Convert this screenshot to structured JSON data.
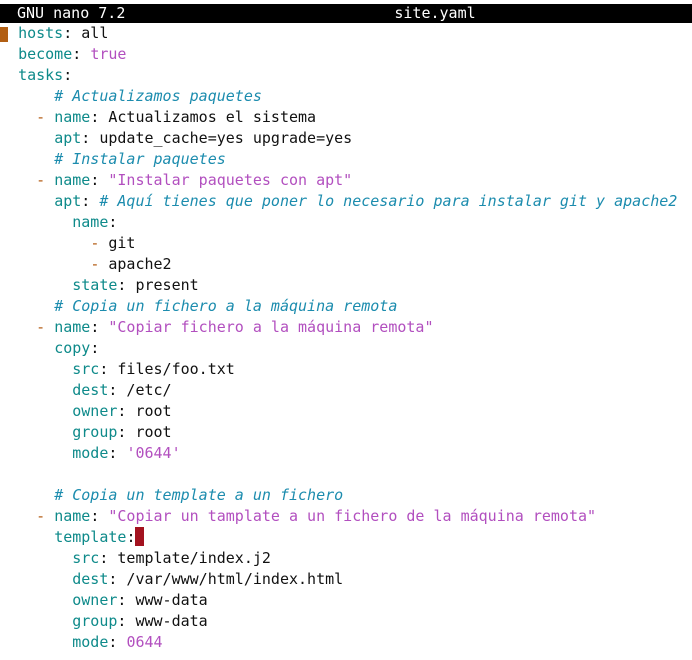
{
  "titlebar": {
    "app": "GNU nano 7.2",
    "filename": "site.yaml"
  },
  "editor": {
    "lines": [
      [
        {
          "t": "hosts",
          "c": "k"
        },
        {
          "t": ": all",
          "c": "p"
        }
      ],
      [
        {
          "t": "become",
          "c": "k"
        },
        {
          "t": ": ",
          "c": "p"
        },
        {
          "t": "true",
          "c": "s"
        }
      ],
      [
        {
          "t": "tasks",
          "c": "k"
        },
        {
          "t": ":",
          "c": "p"
        }
      ],
      [
        {
          "t": "    ",
          "c": "p"
        },
        {
          "t": "# Actualizamos paquetes",
          "c": "c"
        }
      ],
      [
        {
          "t": "  ",
          "c": "p"
        },
        {
          "t": "- ",
          "c": "d"
        },
        {
          "t": "name",
          "c": "k"
        },
        {
          "t": ": Actualizamos el sistema",
          "c": "p"
        }
      ],
      [
        {
          "t": "    ",
          "c": "p"
        },
        {
          "t": "apt",
          "c": "k"
        },
        {
          "t": ": update_cache=yes upgrade=yes",
          "c": "p"
        }
      ],
      [
        {
          "t": "    ",
          "c": "p"
        },
        {
          "t": "# Instalar paquetes",
          "c": "c"
        }
      ],
      [
        {
          "t": "  ",
          "c": "p"
        },
        {
          "t": "- ",
          "c": "d"
        },
        {
          "t": "name",
          "c": "k"
        },
        {
          "t": ": ",
          "c": "p"
        },
        {
          "t": "\"Instalar paquetes con apt\"",
          "c": "s"
        }
      ],
      [
        {
          "t": "    ",
          "c": "p"
        },
        {
          "t": "apt",
          "c": "k"
        },
        {
          "t": ": ",
          "c": "p"
        },
        {
          "t": "# Aquí tienes que poner lo necesario para instalar git y apache2",
          "c": "c"
        }
      ],
      [
        {
          "t": "      ",
          "c": "p"
        },
        {
          "t": "name",
          "c": "k"
        },
        {
          "t": ":",
          "c": "p"
        }
      ],
      [
        {
          "t": "        ",
          "c": "p"
        },
        {
          "t": "- ",
          "c": "d"
        },
        {
          "t": "git",
          "c": "p"
        }
      ],
      [
        {
          "t": "        ",
          "c": "p"
        },
        {
          "t": "- ",
          "c": "d"
        },
        {
          "t": "apache2",
          "c": "p"
        }
      ],
      [
        {
          "t": "      ",
          "c": "p"
        },
        {
          "t": "state",
          "c": "k"
        },
        {
          "t": ": present",
          "c": "p"
        }
      ],
      [
        {
          "t": "    ",
          "c": "p"
        },
        {
          "t": "# Copia un fichero a la máquina remota",
          "c": "c"
        }
      ],
      [
        {
          "t": "  ",
          "c": "p"
        },
        {
          "t": "- ",
          "c": "d"
        },
        {
          "t": "name",
          "c": "k"
        },
        {
          "t": ": ",
          "c": "p"
        },
        {
          "t": "\"Copiar fichero a la máquina remota\"",
          "c": "s"
        }
      ],
      [
        {
          "t": "    ",
          "c": "p"
        },
        {
          "t": "copy",
          "c": "k"
        },
        {
          "t": ":",
          "c": "p"
        }
      ],
      [
        {
          "t": "      ",
          "c": "p"
        },
        {
          "t": "src",
          "c": "k"
        },
        {
          "t": ": files/foo.txt",
          "c": "p"
        }
      ],
      [
        {
          "t": "      ",
          "c": "p"
        },
        {
          "t": "dest",
          "c": "k"
        },
        {
          "t": ": /etc/",
          "c": "p"
        }
      ],
      [
        {
          "t": "      ",
          "c": "p"
        },
        {
          "t": "owner",
          "c": "k"
        },
        {
          "t": ": root",
          "c": "p"
        }
      ],
      [
        {
          "t": "      ",
          "c": "p"
        },
        {
          "t": "group",
          "c": "k"
        },
        {
          "t": ": root",
          "c": "p"
        }
      ],
      [
        {
          "t": "      ",
          "c": "p"
        },
        {
          "t": "mode",
          "c": "k"
        },
        {
          "t": ": ",
          "c": "p"
        },
        {
          "t": "'0644'",
          "c": "s"
        }
      ],
      [],
      [
        {
          "t": "    ",
          "c": "p"
        },
        {
          "t": "# Copia un template a un fichero",
          "c": "c"
        }
      ],
      [
        {
          "t": "  ",
          "c": "p"
        },
        {
          "t": "- ",
          "c": "d"
        },
        {
          "t": "name",
          "c": "k"
        },
        {
          "t": ": ",
          "c": "p"
        },
        {
          "t": "\"Copiar un tamplate a un fichero de la máquina remota\"",
          "c": "s"
        }
      ],
      [
        {
          "t": "    ",
          "c": "p"
        },
        {
          "t": "template",
          "c": "k"
        },
        {
          "t": ":",
          "c": "p"
        },
        {
          "cursor": true
        }
      ],
      [
        {
          "t": "      ",
          "c": "p"
        },
        {
          "t": "src",
          "c": "k"
        },
        {
          "t": ": template/index.j2",
          "c": "p"
        }
      ],
      [
        {
          "t": "      ",
          "c": "p"
        },
        {
          "t": "dest",
          "c": "k"
        },
        {
          "t": ": /var/www/html/index.html",
          "c": "p"
        }
      ],
      [
        {
          "t": "      ",
          "c": "p"
        },
        {
          "t": "owner",
          "c": "k"
        },
        {
          "t": ": www-data",
          "c": "p"
        }
      ],
      [
        {
          "t": "      ",
          "c": "p"
        },
        {
          "t": "group",
          "c": "k"
        },
        {
          "t": ": www-data",
          "c": "p"
        }
      ],
      [
        {
          "t": "      ",
          "c": "p"
        },
        {
          "t": "mode",
          "c": "k"
        },
        {
          "t": ": ",
          "c": "p"
        },
        {
          "t": "0644",
          "c": "s"
        }
      ]
    ]
  }
}
